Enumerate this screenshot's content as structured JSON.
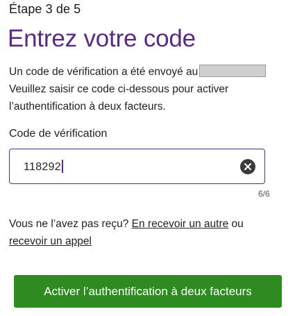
{
  "step": {
    "label": "Étape 3 de 5"
  },
  "header": {
    "title": "Entrez votre code"
  },
  "description": {
    "line1": "Un code de vérification a été envoyé au",
    "line2": "Veuillez saisir ce code ci-dessous pour activer",
    "line3": "l’authentification à deux facteurs."
  },
  "verification": {
    "label": "Code de vérification",
    "value": "118292",
    "counter": "6/6",
    "clear_icon": "clear-circle-icon"
  },
  "resend": {
    "prefix": "Vous ne l’avez pas reçu?",
    "link_other": "En recevoir un autre",
    "or": "ou",
    "link_call": "recevoir un appel"
  },
  "actions": {
    "primary_label": "Activer l’authentification à deux facteurs"
  },
  "colors": {
    "accent": "#5b2a86",
    "primary_button": "#2e8b1f"
  }
}
